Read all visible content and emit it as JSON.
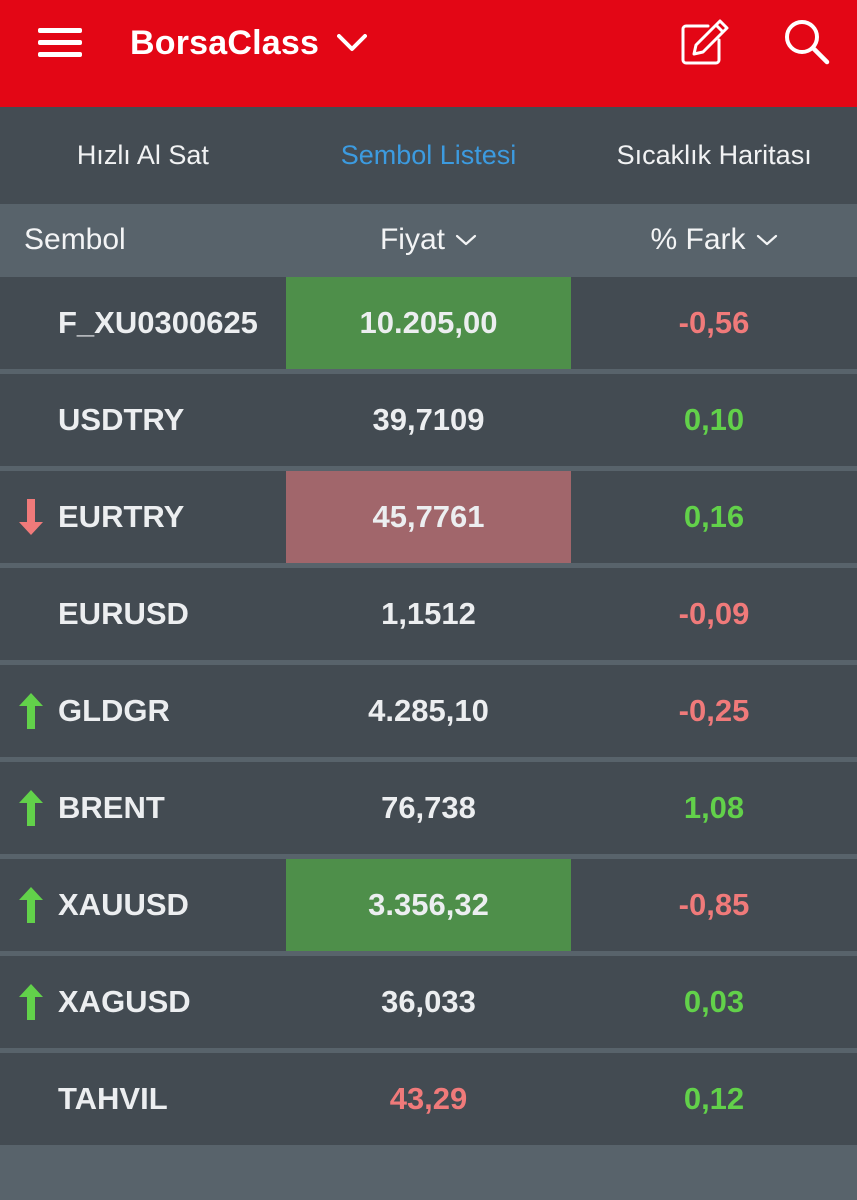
{
  "colors": {
    "brand_red": "#e30615",
    "tab_active": "#3c9be0",
    "positive": "#62d14a",
    "negative": "#f07a7a",
    "flash_up_bg": "#4e8f4a",
    "flash_down_bg": "#a1666b"
  },
  "appbar": {
    "title": "BorsaClass",
    "menu_icon": "hamburger-icon",
    "dropdown_icon": "chevron-down-icon",
    "edit_icon": "edit-icon",
    "search_icon": "search-icon"
  },
  "tabs": [
    {
      "label": "Hızlı Al Sat",
      "active": false
    },
    {
      "label": "Sembol Listesi",
      "active": true
    },
    {
      "label": "Sıcaklık Haritası",
      "active": false
    }
  ],
  "columns": {
    "sembol": "Sembol",
    "fiyat": "Fiyat",
    "fark": "% Fark"
  },
  "rows": [
    {
      "symbol": "F_XU0300625",
      "price": "10.205,00",
      "change": "-0,56",
      "trend": "",
      "flash": "up",
      "price_color": "",
      "change_sign": "negative"
    },
    {
      "symbol": "USDTRY",
      "price": "39,7109",
      "change": "0,10",
      "trend": "",
      "flash": "",
      "price_color": "",
      "change_sign": "positive"
    },
    {
      "symbol": "EURTRY",
      "price": "45,7761",
      "change": "0,16",
      "trend": "down",
      "flash": "down",
      "price_color": "",
      "change_sign": "positive"
    },
    {
      "symbol": "EURUSD",
      "price": "1,1512",
      "change": "-0,09",
      "trend": "",
      "flash": "",
      "price_color": "",
      "change_sign": "negative"
    },
    {
      "symbol": "GLDGR",
      "price": "4.285,10",
      "change": "-0,25",
      "trend": "up",
      "flash": "",
      "price_color": "",
      "change_sign": "negative"
    },
    {
      "symbol": "BRENT",
      "price": "76,738",
      "change": "1,08",
      "trend": "up",
      "flash": "",
      "price_color": "",
      "change_sign": "positive"
    },
    {
      "symbol": "XAUUSD",
      "price": "3.356,32",
      "change": "-0,85",
      "trend": "up",
      "flash": "up",
      "price_color": "",
      "change_sign": "negative"
    },
    {
      "symbol": "XAGUSD",
      "price": "36,033",
      "change": "0,03",
      "trend": "up",
      "flash": "",
      "price_color": "",
      "change_sign": "positive"
    },
    {
      "symbol": "TAHVIL",
      "price": "43,29",
      "change": "0,12",
      "trend": "",
      "flash": "",
      "price_color": "negative",
      "change_sign": "positive"
    }
  ]
}
